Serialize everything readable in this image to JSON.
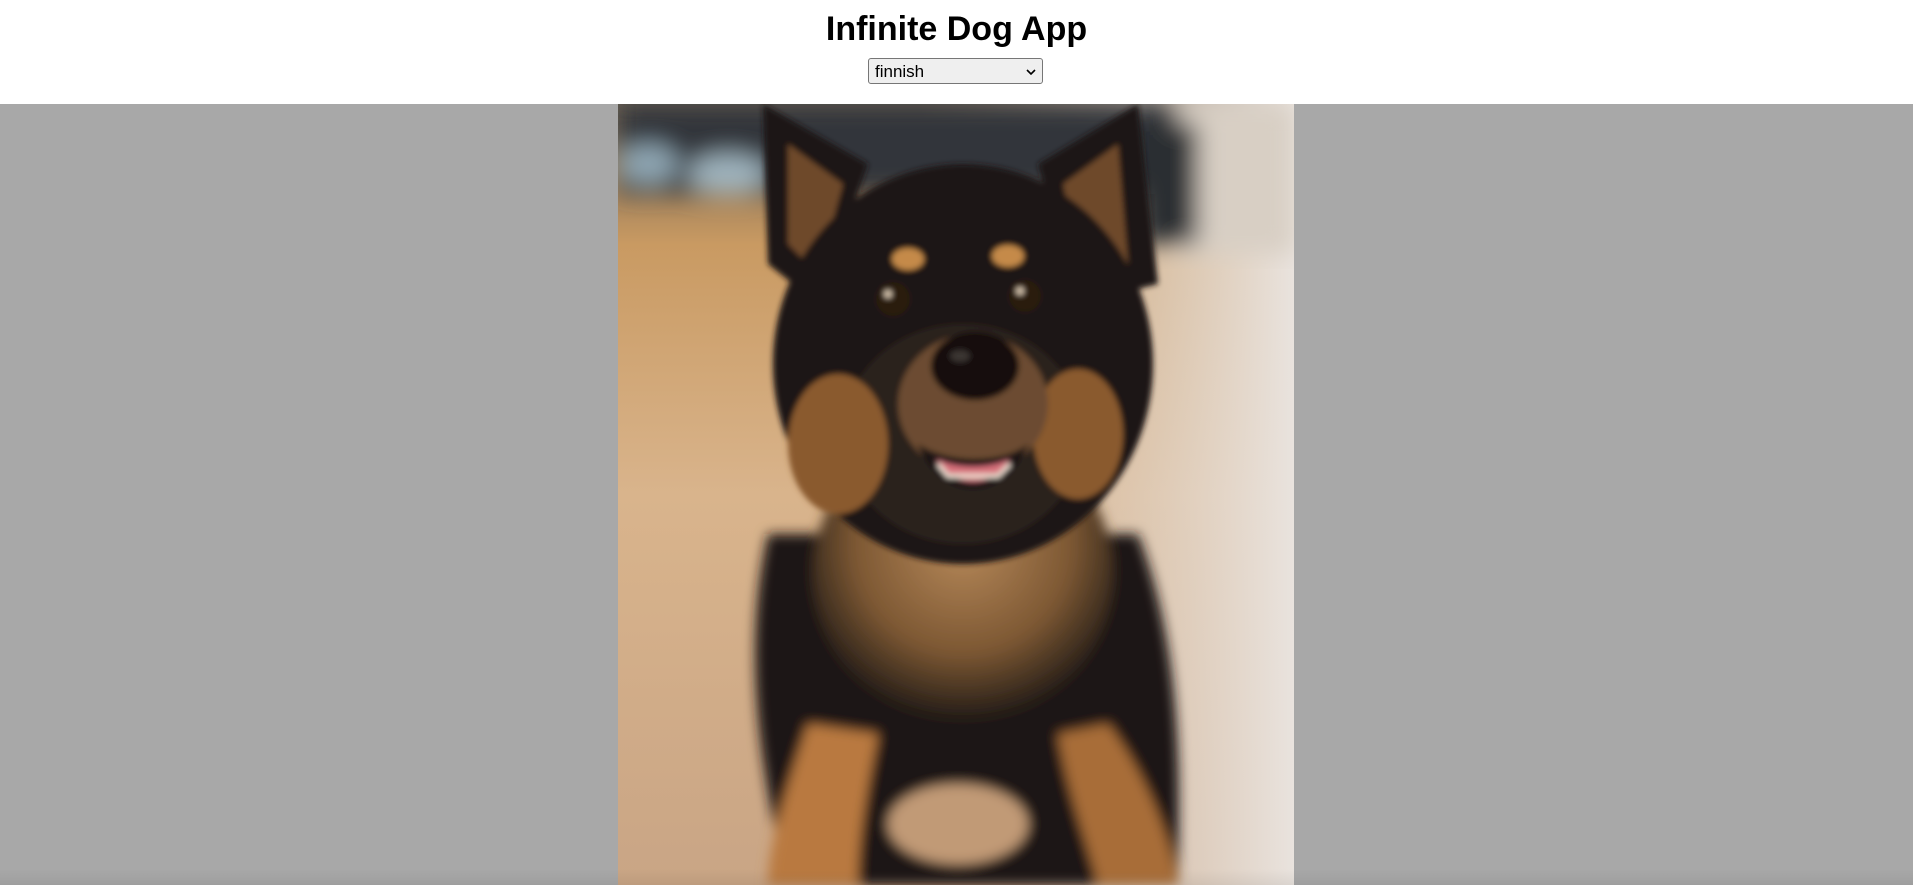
{
  "app": {
    "title": "Infinite Dog App"
  },
  "breed_select": {
    "selected": "finnish"
  },
  "image": {
    "icon": "dog-photo",
    "subject": "finnish lapphund dog"
  },
  "colors": {
    "background": "#a8a8a8",
    "header": "#ffffff"
  }
}
